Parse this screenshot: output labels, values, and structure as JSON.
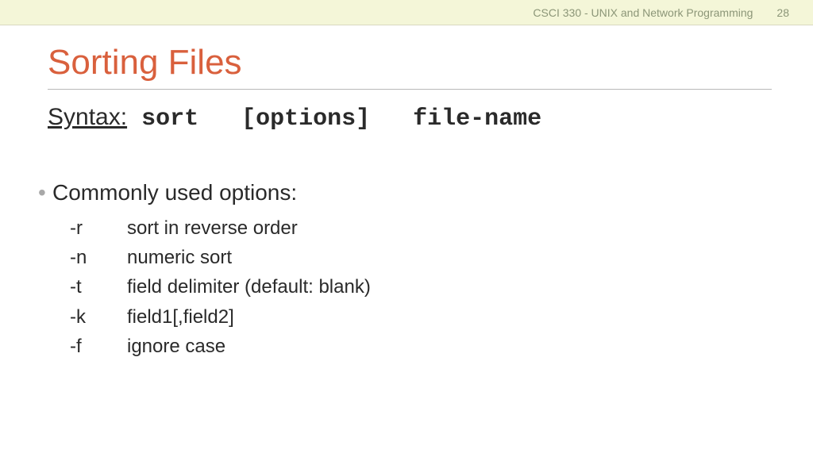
{
  "header": {
    "course": "CSCI 330 - UNIX and Network Programming",
    "page": "28"
  },
  "title": "Sorting Files",
  "syntax": {
    "label": "Syntax:",
    "code": " sort   [options]   file-name"
  },
  "bullet": {
    "marker": "•",
    "heading": "Commonly used options:"
  },
  "options": [
    {
      "flag": "-r",
      "desc": "sort in reverse order"
    },
    {
      "flag": "-n",
      "desc": "numeric sort"
    },
    {
      "flag": "-t",
      "desc": "field delimiter (default: blank)"
    },
    {
      "flag": "-k",
      "desc": "field1[,field2]"
    },
    {
      "flag": "-f",
      "desc": "ignore case"
    }
  ]
}
